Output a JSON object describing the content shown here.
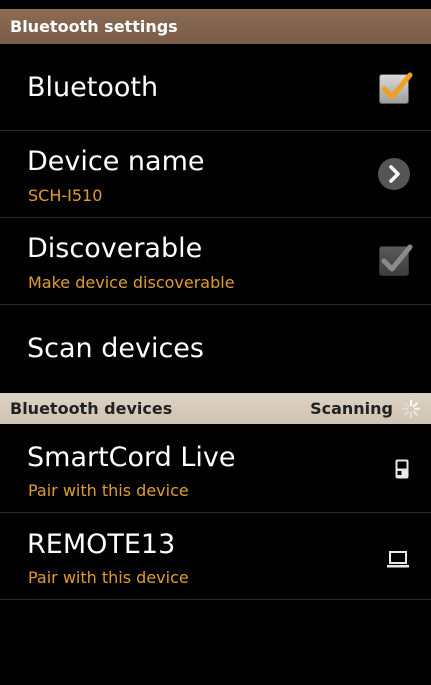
{
  "header": {
    "title": "Bluetooth settings"
  },
  "settings": {
    "bluetooth": {
      "label": "Bluetooth",
      "checked": true
    },
    "device_name": {
      "label": "Device name",
      "value": "SCH-I510"
    },
    "discoverable": {
      "label": "Discoverable",
      "subtitle": "Make device discoverable",
      "checked": true,
      "enabled": false
    },
    "scan": {
      "label": "Scan devices"
    }
  },
  "devices_section": {
    "title": "Bluetooth devices",
    "status": "Scanning"
  },
  "devices": [
    {
      "name": "SmartCord Live",
      "subtitle": "Pair with this device",
      "icon": "phone-icon"
    },
    {
      "name": "REMOTE13",
      "subtitle": "Pair with this device",
      "icon": "laptop-icon"
    }
  ],
  "colors": {
    "accent": "#e09d2d",
    "header": "#7f6450",
    "section": "#d8cdbd"
  }
}
